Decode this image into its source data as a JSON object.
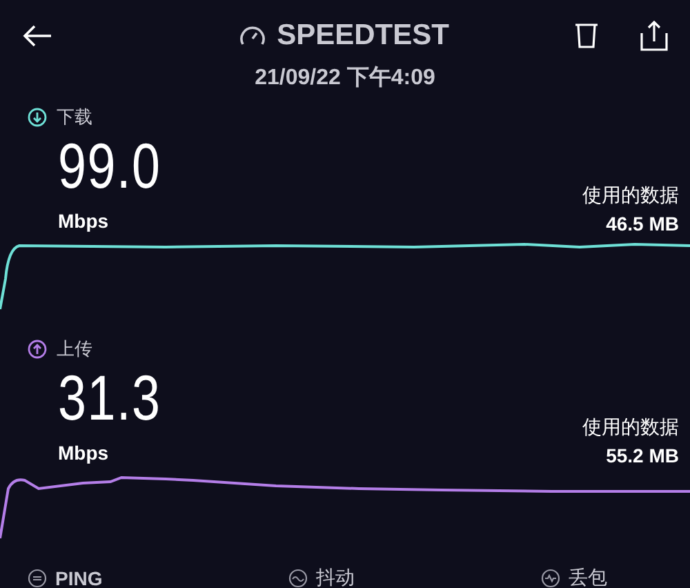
{
  "header": {
    "title": "SPEEDTEST",
    "datetime": "21/09/22 下午4:09"
  },
  "sections": [
    {
      "kind": "download",
      "label": "下载",
      "value": "99.0",
      "unit": "Mbps",
      "data_label": "使用的数据",
      "data_value": "46.5 MB"
    },
    {
      "kind": "upload",
      "label": "上传",
      "value": "31.3",
      "unit": "Mbps",
      "data_label": "使用的数据",
      "data_value": "55.2 MB"
    }
  ],
  "footer": [
    {
      "kind": "ping",
      "label": "PING"
    },
    {
      "kind": "jitter",
      "label": "抖动"
    },
    {
      "kind": "loss",
      "label": "丢包"
    }
  ]
}
